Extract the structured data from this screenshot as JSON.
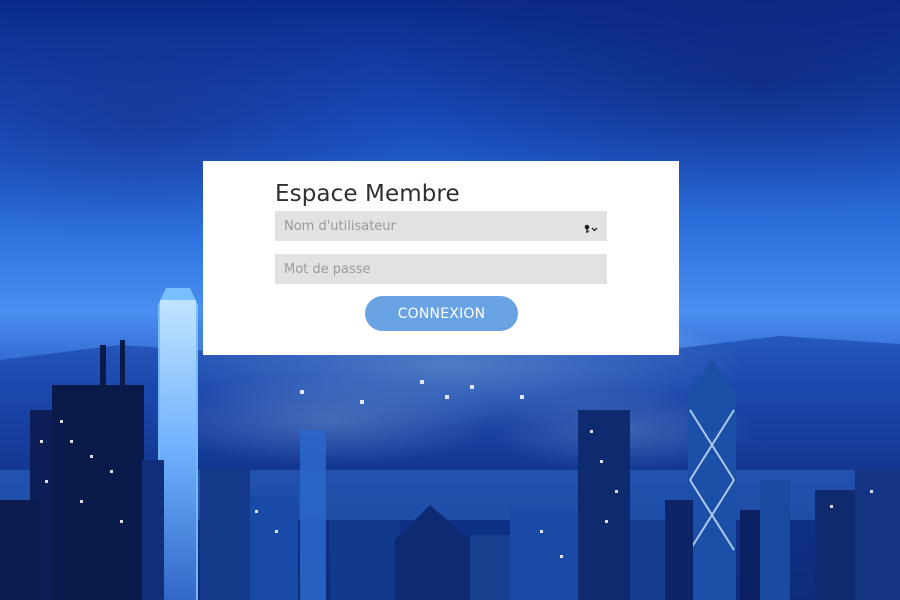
{
  "background": {
    "description_icon": "city-night-skyline-image"
  },
  "login": {
    "title": "Espace Membre",
    "username_placeholder": "Nom d'utilisateur",
    "username_value": "",
    "password_placeholder": "Mot de passe",
    "password_value": "",
    "submit_label": "CONNEXION",
    "key_icon": "key-dropdown-icon"
  },
  "colors": {
    "card_bg": "#ffffff",
    "field_bg": "#e2e2e2",
    "button_bg": "#6aa3e4",
    "title_text": "#2f2f2f"
  }
}
